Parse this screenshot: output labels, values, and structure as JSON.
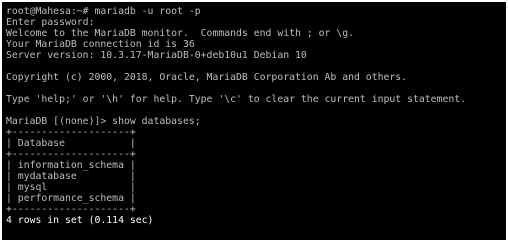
{
  "colors": {
    "background": "#000000",
    "text_dim": "#bdbdbd",
    "text_bright": "#ffffff"
  },
  "terminal": {
    "shell_prompt": "root@Mahesa:~# mariadb -u root -p",
    "password_prompt": "Enter password:",
    "welcome": "Welcome to the MariaDB monitor.  Commands end with ; or \\g.",
    "connection_id": "Your MariaDB connection id is 36",
    "server_version": "Server version: 10.3.17-MariaDB-0+deb10u1 Debian 10",
    "copyright": "Copyright (c) 2000, 2018, Oracle, MariaDB Corporation Ab and others.",
    "help_hint": "Type 'help;' or '\\h' for help. Type '\\c' to clear the current input statement.",
    "mariadb_command": "MariaDB [(none)]> show databases;",
    "table_border_top": "+--------------------+",
    "table_header": "| Database           |",
    "table_border_mid": "+--------------------+",
    "rows": [
      "| information_schema |",
      "| mydatabase         |",
      "| mysql              |",
      "| performance_schema |"
    ],
    "table_border_bottom": "+--------------------+",
    "result_summary": "4 rows in set (0.114 sec)"
  }
}
